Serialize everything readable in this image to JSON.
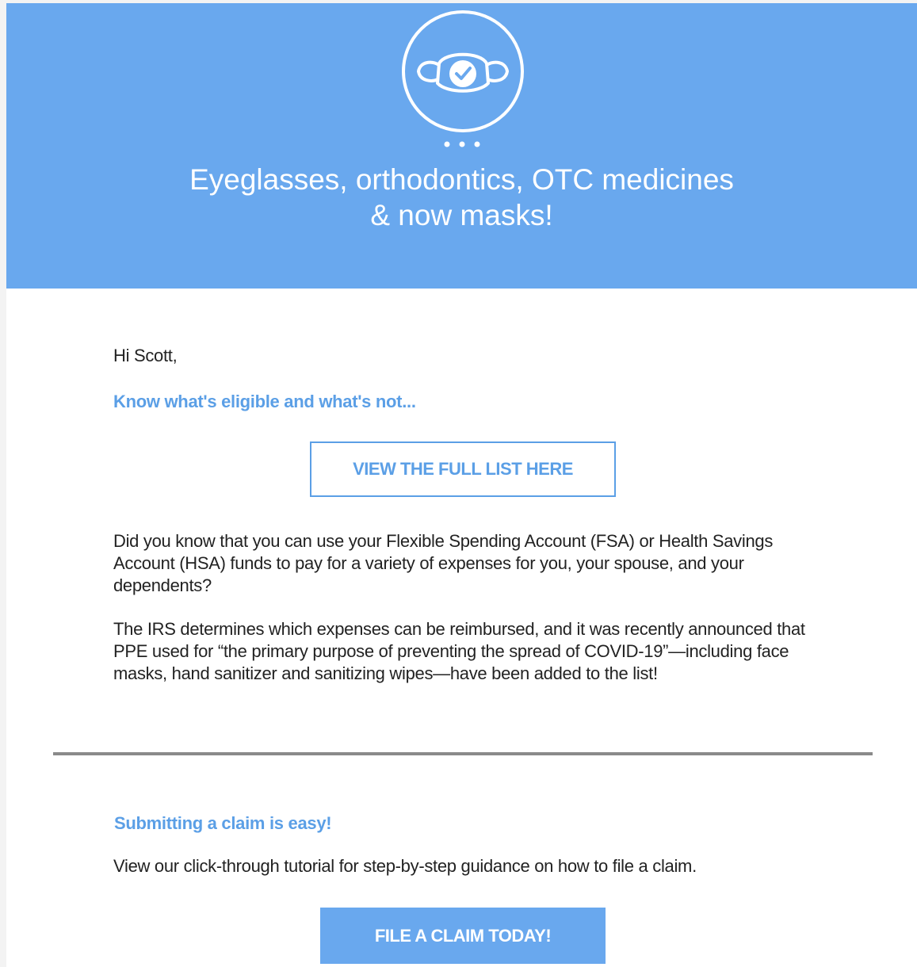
{
  "hero": {
    "icon": "face-mask-check-icon",
    "title_line1": "Eyeglasses, orthodontics, OTC medicines",
    "title_line2": "& now masks!"
  },
  "body": {
    "greeting": "Hi Scott,",
    "eligible_heading": "Know what's eligible and what's not...",
    "view_list_button": "VIEW THE FULL LIST HERE",
    "paragraph1": "Did you know that you can use your Flexible Spending Account (FSA) or Health Savings Account (HSA) funds to pay for a variety of expenses for you, your spouse, and your dependents?",
    "paragraph2": "The IRS determines which expenses can be reimbursed, and it was recently announced that PPE used for “the primary purpose of preventing the spread of COVID-19”—including face masks, hand sanitizer and sanitizing wipes—have been added to the list!",
    "claim_heading": "Submitting a claim is easy!",
    "paragraph3": "View our click-through tutorial for step-by-step guidance on how to file a claim.",
    "file_claim_button": "FILE A CLAIM TODAY!"
  },
  "colors": {
    "hero_background": "#69a8ee",
    "accent_text": "#5b9fe6",
    "divider": "#8a8a8a"
  }
}
